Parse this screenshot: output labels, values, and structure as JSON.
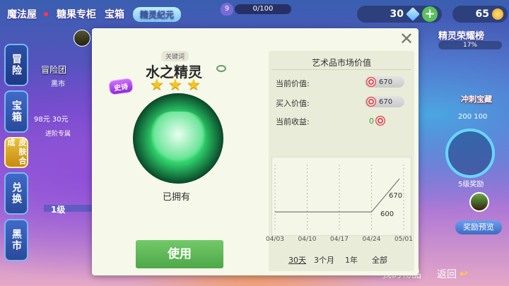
{
  "topbar": {
    "nav1": "魔法屋",
    "nav2": "糖果专柜",
    "nav3": "宝箱",
    "title_badge": "精灵纪元",
    "level": "9",
    "xp": "0/100",
    "gems": "30",
    "coins": "65"
  },
  "left_nav": {
    "items": [
      "冒险",
      "宝箱",
      "皮肤合成",
      "兑换",
      "黑市"
    ],
    "adventure_team": "冒险团",
    "adventure_sub": "黑市",
    "price": "98元  30元",
    "advance": "进阶专属",
    "level": "1级"
  },
  "right_panel": {
    "title": "精灵荣耀榜",
    "progress": "17%",
    "sprint": "冲刺宝藏",
    "sprint_price": "200  100",
    "five_reward": "5级奖励",
    "preview_button": "奖励预览"
  },
  "bottombar": {
    "my_items": "我的物品",
    "back": "返回"
  },
  "dialog": {
    "keyword": "关键词",
    "name": "水之精灵",
    "rarity": "史诗",
    "stars": 3,
    "owned": "已拥有",
    "use_button": "使用",
    "market": {
      "title": "艺术品市场价值",
      "current_value_label": "当前价值:",
      "current_value": "670",
      "buy_value_label": "买入价值:",
      "buy_value": "670",
      "current_gain_label": "当前收益:",
      "current_gain": "0",
      "high_label": "670",
      "low_label": "600",
      "ranges": [
        "30天",
        "3个月",
        "1年",
        "全部"
      ]
    }
  },
  "chart_data": {
    "type": "line",
    "title": "艺术品市场价值",
    "x": [
      "04/03",
      "04/10",
      "04/17",
      "04/24",
      "05/01"
    ],
    "series": [
      {
        "values": [
          600,
          600,
          600,
          600,
          670
        ]
      }
    ],
    "xlabel": "",
    "ylabel": "",
    "grid": false
  }
}
